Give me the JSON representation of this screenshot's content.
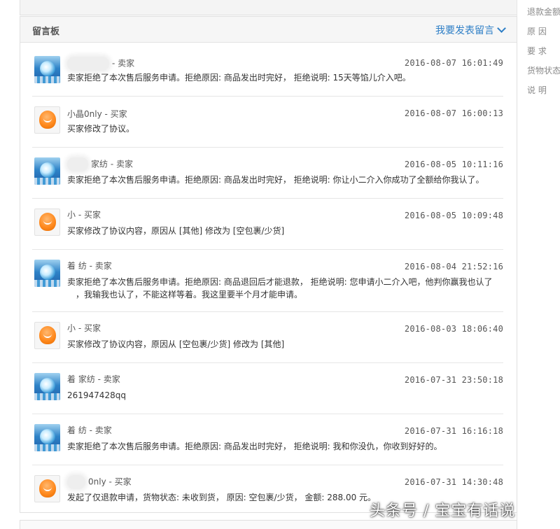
{
  "right_panel": {
    "refund_amount": "退款金额",
    "reason": "原 因",
    "requirement": "要 求",
    "goods_status": "货物状态",
    "description": "说 明"
  },
  "board": {
    "title": "留言板",
    "post_link": "我要发表留言"
  },
  "messages": [
    {
      "author": "- 卖家",
      "time": "2016-08-07 16:01:49",
      "content": "卖家拒绝了本次售后服务申请。拒绝原因: 商品发出时完好， 拒绝说明: 15天等馅儿介入吧。",
      "avatar": "ocean-avatar"
    },
    {
      "author": "小晶0nly - 买家",
      "time": "2016-08-07 16:00:13",
      "content": "买家修改了协议。",
      "avatar": "orange-avatar"
    },
    {
      "author": "家纺 - 卖家",
      "time": "2016-08-05 10:11:16",
      "content": "卖家拒绝了本次售后服务申请。拒绝原因: 商品发出时完好， 拒绝说明: 你让小二介入你成功了全额给你我认了。",
      "avatar": "ocean-avatar"
    },
    {
      "author": "小 - 买家",
      "time": "2016-08-05 10:09:48",
      "content": "买家修改了协议内容，原因从 [其他] 修改为 [空包裹/少货]",
      "avatar": "orange-avatar"
    },
    {
      "author": "着 纺 - 卖家",
      "time": "2016-08-04 21:52:16",
      "content": "卖家拒绝了本次售后服务申请。拒绝原因: 商品退回后才能退款， 拒绝说明: 您申请小二介入吧，他判你赢我也认了",
      "content2": "，我输我也认了，不能这样等着。我这里要半个月才能申请。",
      "avatar": "ocean-avatar"
    },
    {
      "author": "小 - 买家",
      "time": "2016-08-03 18:06:40",
      "content": "买家修改了协议内容，原因从 [空包裹/少货] 修改为 [其他]",
      "avatar": "orange-avatar"
    },
    {
      "author": "着 家纺 - 卖家",
      "time": "2016-07-31 23:50:18",
      "content": "261947428qq",
      "avatar": "ocean-avatar"
    },
    {
      "author": "着 纺 - 卖家",
      "time": "2016-07-31 16:16:18",
      "content": "卖家拒绝了本次售后服务申请。拒绝原因: 商品发出时完好， 拒绝说明: 我和你没仇，你收到好好的。",
      "avatar": "ocean-avatar"
    },
    {
      "author": "0nly - 买家",
      "time": "2016-07-31 14:30:48",
      "content": "发起了仅退款申请，货物状态: 未收到货， 原因: 空包裹/少货， 金额: 288.00 元。",
      "avatar": "orange-avatar"
    }
  ],
  "watermark": "头条号 / 宝宝有话说"
}
